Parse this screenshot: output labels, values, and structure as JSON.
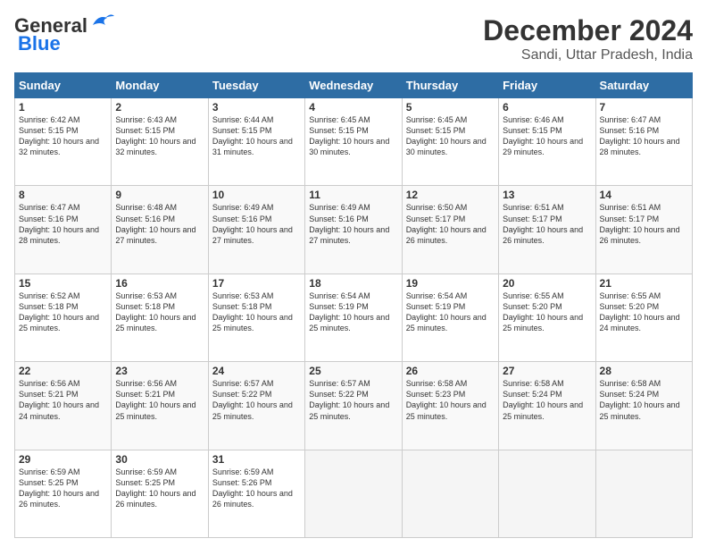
{
  "header": {
    "logo_line1": "General",
    "logo_line2": "Blue",
    "title": "December 2024",
    "subtitle": "Sandi, Uttar Pradesh, India"
  },
  "columns": [
    "Sunday",
    "Monday",
    "Tuesday",
    "Wednesday",
    "Thursday",
    "Friday",
    "Saturday"
  ],
  "weeks": [
    [
      {
        "day": "1",
        "sunrise": "Sunrise: 6:42 AM",
        "sunset": "Sunset: 5:15 PM",
        "daylight": "Daylight: 10 hours and 32 minutes."
      },
      {
        "day": "2",
        "sunrise": "Sunrise: 6:43 AM",
        "sunset": "Sunset: 5:15 PM",
        "daylight": "Daylight: 10 hours and 32 minutes."
      },
      {
        "day": "3",
        "sunrise": "Sunrise: 6:44 AM",
        "sunset": "Sunset: 5:15 PM",
        "daylight": "Daylight: 10 hours and 31 minutes."
      },
      {
        "day": "4",
        "sunrise": "Sunrise: 6:45 AM",
        "sunset": "Sunset: 5:15 PM",
        "daylight": "Daylight: 10 hours and 30 minutes."
      },
      {
        "day": "5",
        "sunrise": "Sunrise: 6:45 AM",
        "sunset": "Sunset: 5:15 PM",
        "daylight": "Daylight: 10 hours and 30 minutes."
      },
      {
        "day": "6",
        "sunrise": "Sunrise: 6:46 AM",
        "sunset": "Sunset: 5:15 PM",
        "daylight": "Daylight: 10 hours and 29 minutes."
      },
      {
        "day": "7",
        "sunrise": "Sunrise: 6:47 AM",
        "sunset": "Sunset: 5:16 PM",
        "daylight": "Daylight: 10 hours and 28 minutes."
      }
    ],
    [
      {
        "day": "8",
        "sunrise": "Sunrise: 6:47 AM",
        "sunset": "Sunset: 5:16 PM",
        "daylight": "Daylight: 10 hours and 28 minutes."
      },
      {
        "day": "9",
        "sunrise": "Sunrise: 6:48 AM",
        "sunset": "Sunset: 5:16 PM",
        "daylight": "Daylight: 10 hours and 27 minutes."
      },
      {
        "day": "10",
        "sunrise": "Sunrise: 6:49 AM",
        "sunset": "Sunset: 5:16 PM",
        "daylight": "Daylight: 10 hours and 27 minutes."
      },
      {
        "day": "11",
        "sunrise": "Sunrise: 6:49 AM",
        "sunset": "Sunset: 5:16 PM",
        "daylight": "Daylight: 10 hours and 27 minutes."
      },
      {
        "day": "12",
        "sunrise": "Sunrise: 6:50 AM",
        "sunset": "Sunset: 5:17 PM",
        "daylight": "Daylight: 10 hours and 26 minutes."
      },
      {
        "day": "13",
        "sunrise": "Sunrise: 6:51 AM",
        "sunset": "Sunset: 5:17 PM",
        "daylight": "Daylight: 10 hours and 26 minutes."
      },
      {
        "day": "14",
        "sunrise": "Sunrise: 6:51 AM",
        "sunset": "Sunset: 5:17 PM",
        "daylight": "Daylight: 10 hours and 26 minutes."
      }
    ],
    [
      {
        "day": "15",
        "sunrise": "Sunrise: 6:52 AM",
        "sunset": "Sunset: 5:18 PM",
        "daylight": "Daylight: 10 hours and 25 minutes."
      },
      {
        "day": "16",
        "sunrise": "Sunrise: 6:53 AM",
        "sunset": "Sunset: 5:18 PM",
        "daylight": "Daylight: 10 hours and 25 minutes."
      },
      {
        "day": "17",
        "sunrise": "Sunrise: 6:53 AM",
        "sunset": "Sunset: 5:18 PM",
        "daylight": "Daylight: 10 hours and 25 minutes."
      },
      {
        "day": "18",
        "sunrise": "Sunrise: 6:54 AM",
        "sunset": "Sunset: 5:19 PM",
        "daylight": "Daylight: 10 hours and 25 minutes."
      },
      {
        "day": "19",
        "sunrise": "Sunrise: 6:54 AM",
        "sunset": "Sunset: 5:19 PM",
        "daylight": "Daylight: 10 hours and 25 minutes."
      },
      {
        "day": "20",
        "sunrise": "Sunrise: 6:55 AM",
        "sunset": "Sunset: 5:20 PM",
        "daylight": "Daylight: 10 hours and 25 minutes."
      },
      {
        "day": "21",
        "sunrise": "Sunrise: 6:55 AM",
        "sunset": "Sunset: 5:20 PM",
        "daylight": "Daylight: 10 hours and 24 minutes."
      }
    ],
    [
      {
        "day": "22",
        "sunrise": "Sunrise: 6:56 AM",
        "sunset": "Sunset: 5:21 PM",
        "daylight": "Daylight: 10 hours and 24 minutes."
      },
      {
        "day": "23",
        "sunrise": "Sunrise: 6:56 AM",
        "sunset": "Sunset: 5:21 PM",
        "daylight": "Daylight: 10 hours and 25 minutes."
      },
      {
        "day": "24",
        "sunrise": "Sunrise: 6:57 AM",
        "sunset": "Sunset: 5:22 PM",
        "daylight": "Daylight: 10 hours and 25 minutes."
      },
      {
        "day": "25",
        "sunrise": "Sunrise: 6:57 AM",
        "sunset": "Sunset: 5:22 PM",
        "daylight": "Daylight: 10 hours and 25 minutes."
      },
      {
        "day": "26",
        "sunrise": "Sunrise: 6:58 AM",
        "sunset": "Sunset: 5:23 PM",
        "daylight": "Daylight: 10 hours and 25 minutes."
      },
      {
        "day": "27",
        "sunrise": "Sunrise: 6:58 AM",
        "sunset": "Sunset: 5:24 PM",
        "daylight": "Daylight: 10 hours and 25 minutes."
      },
      {
        "day": "28",
        "sunrise": "Sunrise: 6:58 AM",
        "sunset": "Sunset: 5:24 PM",
        "daylight": "Daylight: 10 hours and 25 minutes."
      }
    ],
    [
      {
        "day": "29",
        "sunrise": "Sunrise: 6:59 AM",
        "sunset": "Sunset: 5:25 PM",
        "daylight": "Daylight: 10 hours and 26 minutes."
      },
      {
        "day": "30",
        "sunrise": "Sunrise: 6:59 AM",
        "sunset": "Sunset: 5:25 PM",
        "daylight": "Daylight: 10 hours and 26 minutes."
      },
      {
        "day": "31",
        "sunrise": "Sunrise: 6:59 AM",
        "sunset": "Sunset: 5:26 PM",
        "daylight": "Daylight: 10 hours and 26 minutes."
      },
      null,
      null,
      null,
      null
    ]
  ]
}
